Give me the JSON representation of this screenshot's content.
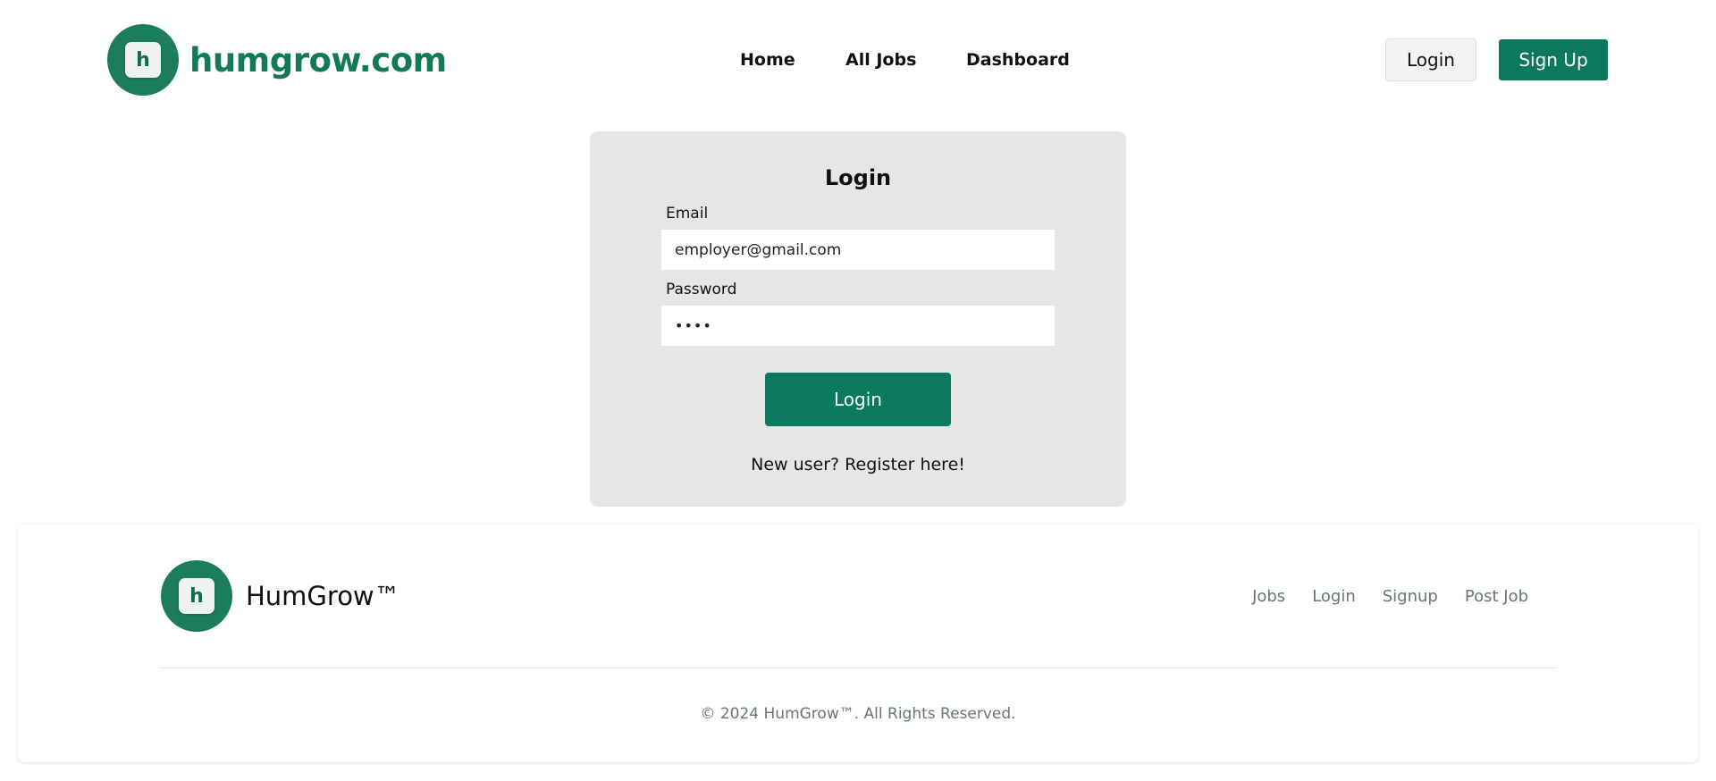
{
  "header": {
    "brand": "humgrow.com",
    "logo_letter": "h",
    "nav": [
      "Home",
      "All Jobs",
      "Dashboard"
    ],
    "login_label": "Login",
    "signup_label": "Sign Up"
  },
  "login_form": {
    "title": "Login",
    "email_label": "Email",
    "email_value": "employer@gmail.com",
    "password_label": "Password",
    "password_value": "••••",
    "submit_label": "Login",
    "register_text": "New user? Register here!"
  },
  "footer": {
    "brand": "HumGrow™",
    "logo_letter": "h",
    "links": [
      "Jobs",
      "Login",
      "Signup",
      "Post Job"
    ],
    "copyright": "© 2024 HumGrow™. All Rights Reserved."
  },
  "colors": {
    "brand_green": "#0b7a5c",
    "card_bg": "#e6e6e6"
  }
}
